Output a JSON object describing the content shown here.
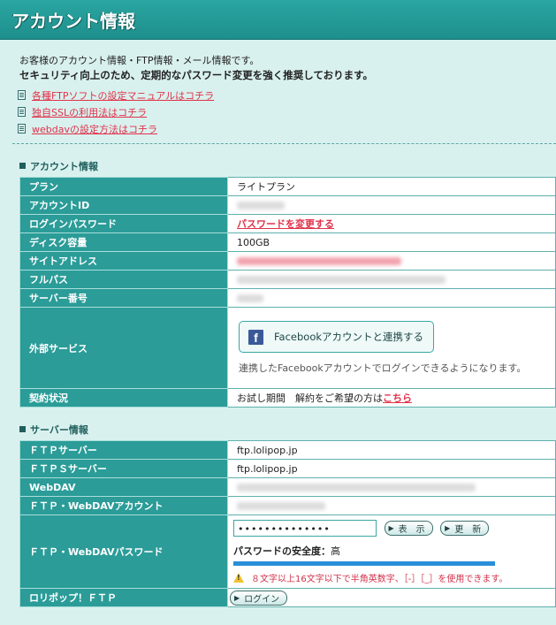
{
  "page": {
    "title": "アカウント情報"
  },
  "intro": {
    "line1": "お客様のアカウント情報・FTP情報・メール情報です。",
    "line2": "セキュリティ向上のため、定期的なパスワード変更を強く推奨しております。"
  },
  "links": [
    {
      "label": "各種FTPソフトの設定マニュアルはコチラ"
    },
    {
      "label": "独自SSLの利用法はコチラ"
    },
    {
      "label": "webdavの設定方法はコチラ"
    }
  ],
  "account": {
    "heading": "アカウント情報",
    "rows": {
      "plan": {
        "label": "プラン",
        "value": "ライトプラン"
      },
      "account_id": {
        "label": "アカウントID"
      },
      "login_password": {
        "label": "ログインパスワード",
        "link": "パスワードを変更する"
      },
      "disk": {
        "label": "ディスク容量",
        "value": "100GB"
      },
      "site_address": {
        "label": "サイトアドレス"
      },
      "full_path": {
        "label": "フルパス"
      },
      "server_number": {
        "label": "サーバー番号"
      },
      "external": {
        "label": "外部サービス",
        "button": "Facebookアカウントと連携する",
        "note": "連携したFacebookアカウントでログインできるようになります。"
      },
      "contract": {
        "label": "契約状況",
        "value": "お試し期間　解約をご希望の方は",
        "link": "こちら"
      }
    }
  },
  "server": {
    "heading": "サーバー情報",
    "rows": {
      "ftp": {
        "label": "ＦＴＰサーバー",
        "value": "ftp.lolipop.jp"
      },
      "ftps": {
        "label": "ＦＴＰＳサーバー",
        "value": "ftp.lolipop.jp"
      },
      "webdav": {
        "label": "WebDAV"
      },
      "ftp_account": {
        "label": "ＦＴＰ・WebDAVアカウント"
      },
      "ftp_password": {
        "label": "ＦＴＰ・WebDAVパスワード",
        "masked_value": "••••••••••••••",
        "show_button": "表　示",
        "update_button": "更　新",
        "strength_label": "パスワードの安全度：",
        "strength_value": "高",
        "warning": "８文字以上16文字以下で半角英数字、［-］［_］を使用できます。"
      },
      "lolipop_ftp": {
        "label": "ロリポップ！ＦＴＰ",
        "login_button": "ログイン"
      }
    }
  },
  "colors": {
    "header": "#2aa6a2",
    "label_cell": "#2b9c98",
    "link_red": "#e0324a",
    "background": "#d9f1ee"
  },
  "icons": [
    "doc-icon",
    "facebook-icon",
    "warning-icon",
    "arrow-icon"
  ]
}
